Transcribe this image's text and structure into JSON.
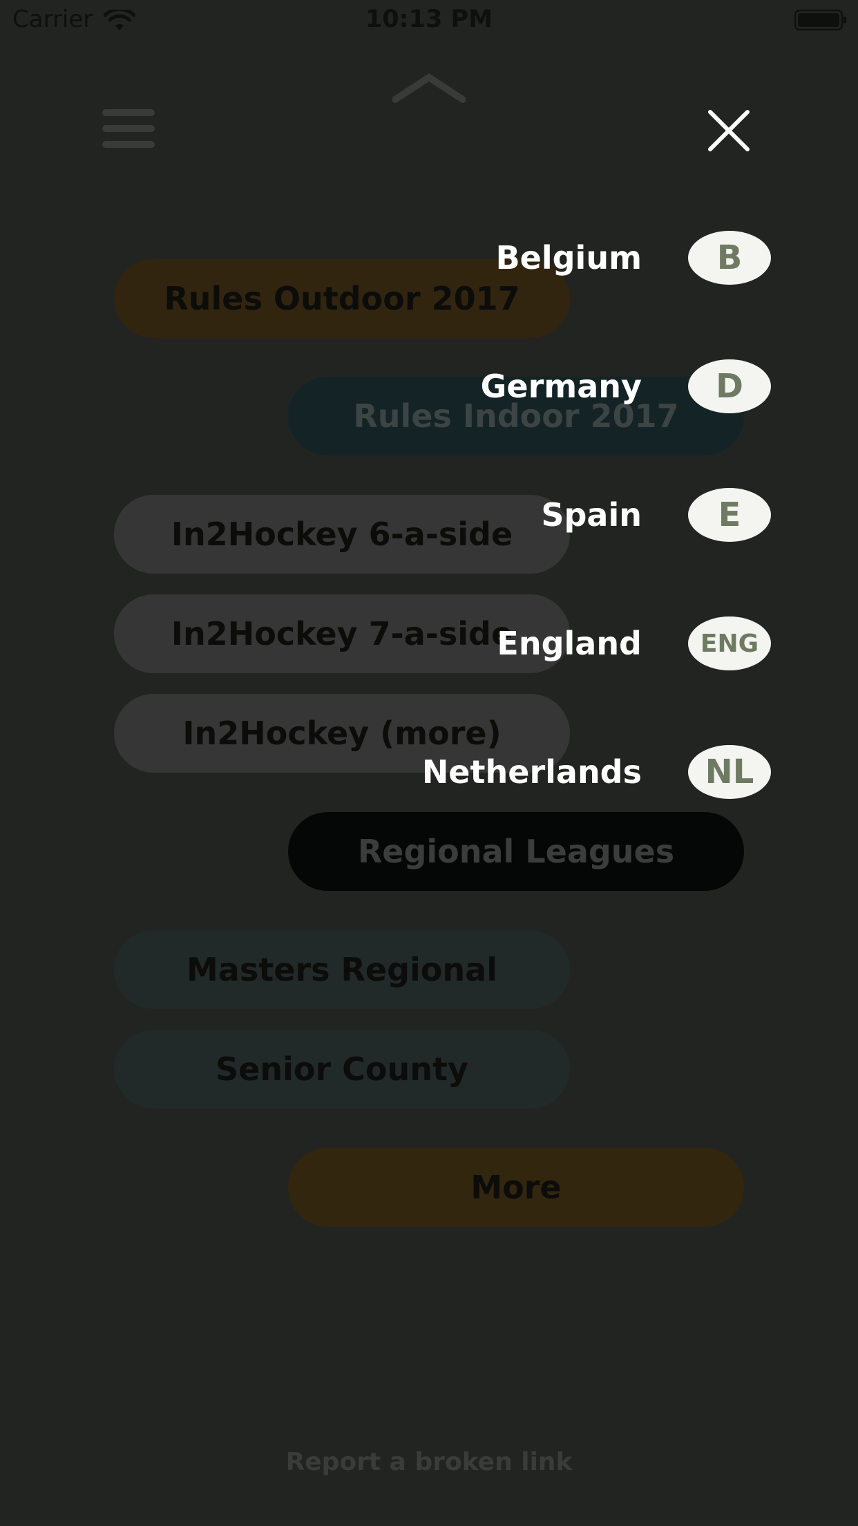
{
  "status_bar": {
    "carrier": "Carrier",
    "time": "10:13 PM",
    "icons": [
      "wifi-icon",
      "battery-icon"
    ]
  },
  "header": {
    "icons": [
      "chevron-up-icon",
      "hamburger-menu-icon",
      "close-icon"
    ]
  },
  "menu": {
    "items": [
      {
        "label": "Rules Outdoor 2017"
      },
      {
        "label": "Rules Indoor 2017"
      },
      {
        "label": "In2Hockey 6-a-side"
      },
      {
        "label": "In2Hockey 7-a-side"
      },
      {
        "label": "In2Hockey (more)"
      },
      {
        "label": "Regional Leagues"
      },
      {
        "label": "Masters Regional"
      },
      {
        "label": "Senior County"
      },
      {
        "label": "More"
      }
    ]
  },
  "footer": {
    "report_link": "Report a broken link"
  },
  "languages": [
    {
      "name": "Belgium",
      "code": "B"
    },
    {
      "name": "Germany",
      "code": "D"
    },
    {
      "name": "Spain",
      "code": "E"
    },
    {
      "name": "England",
      "code": "ENG"
    },
    {
      "name": "Netherlands",
      "code": "NL"
    }
  ],
  "colors": {
    "background": "#222421",
    "badge_bg": "#f4f4f0",
    "badge_text": "#6f7a63",
    "outdoor_pill": "#32250f",
    "indoor_pill": "#142326"
  }
}
